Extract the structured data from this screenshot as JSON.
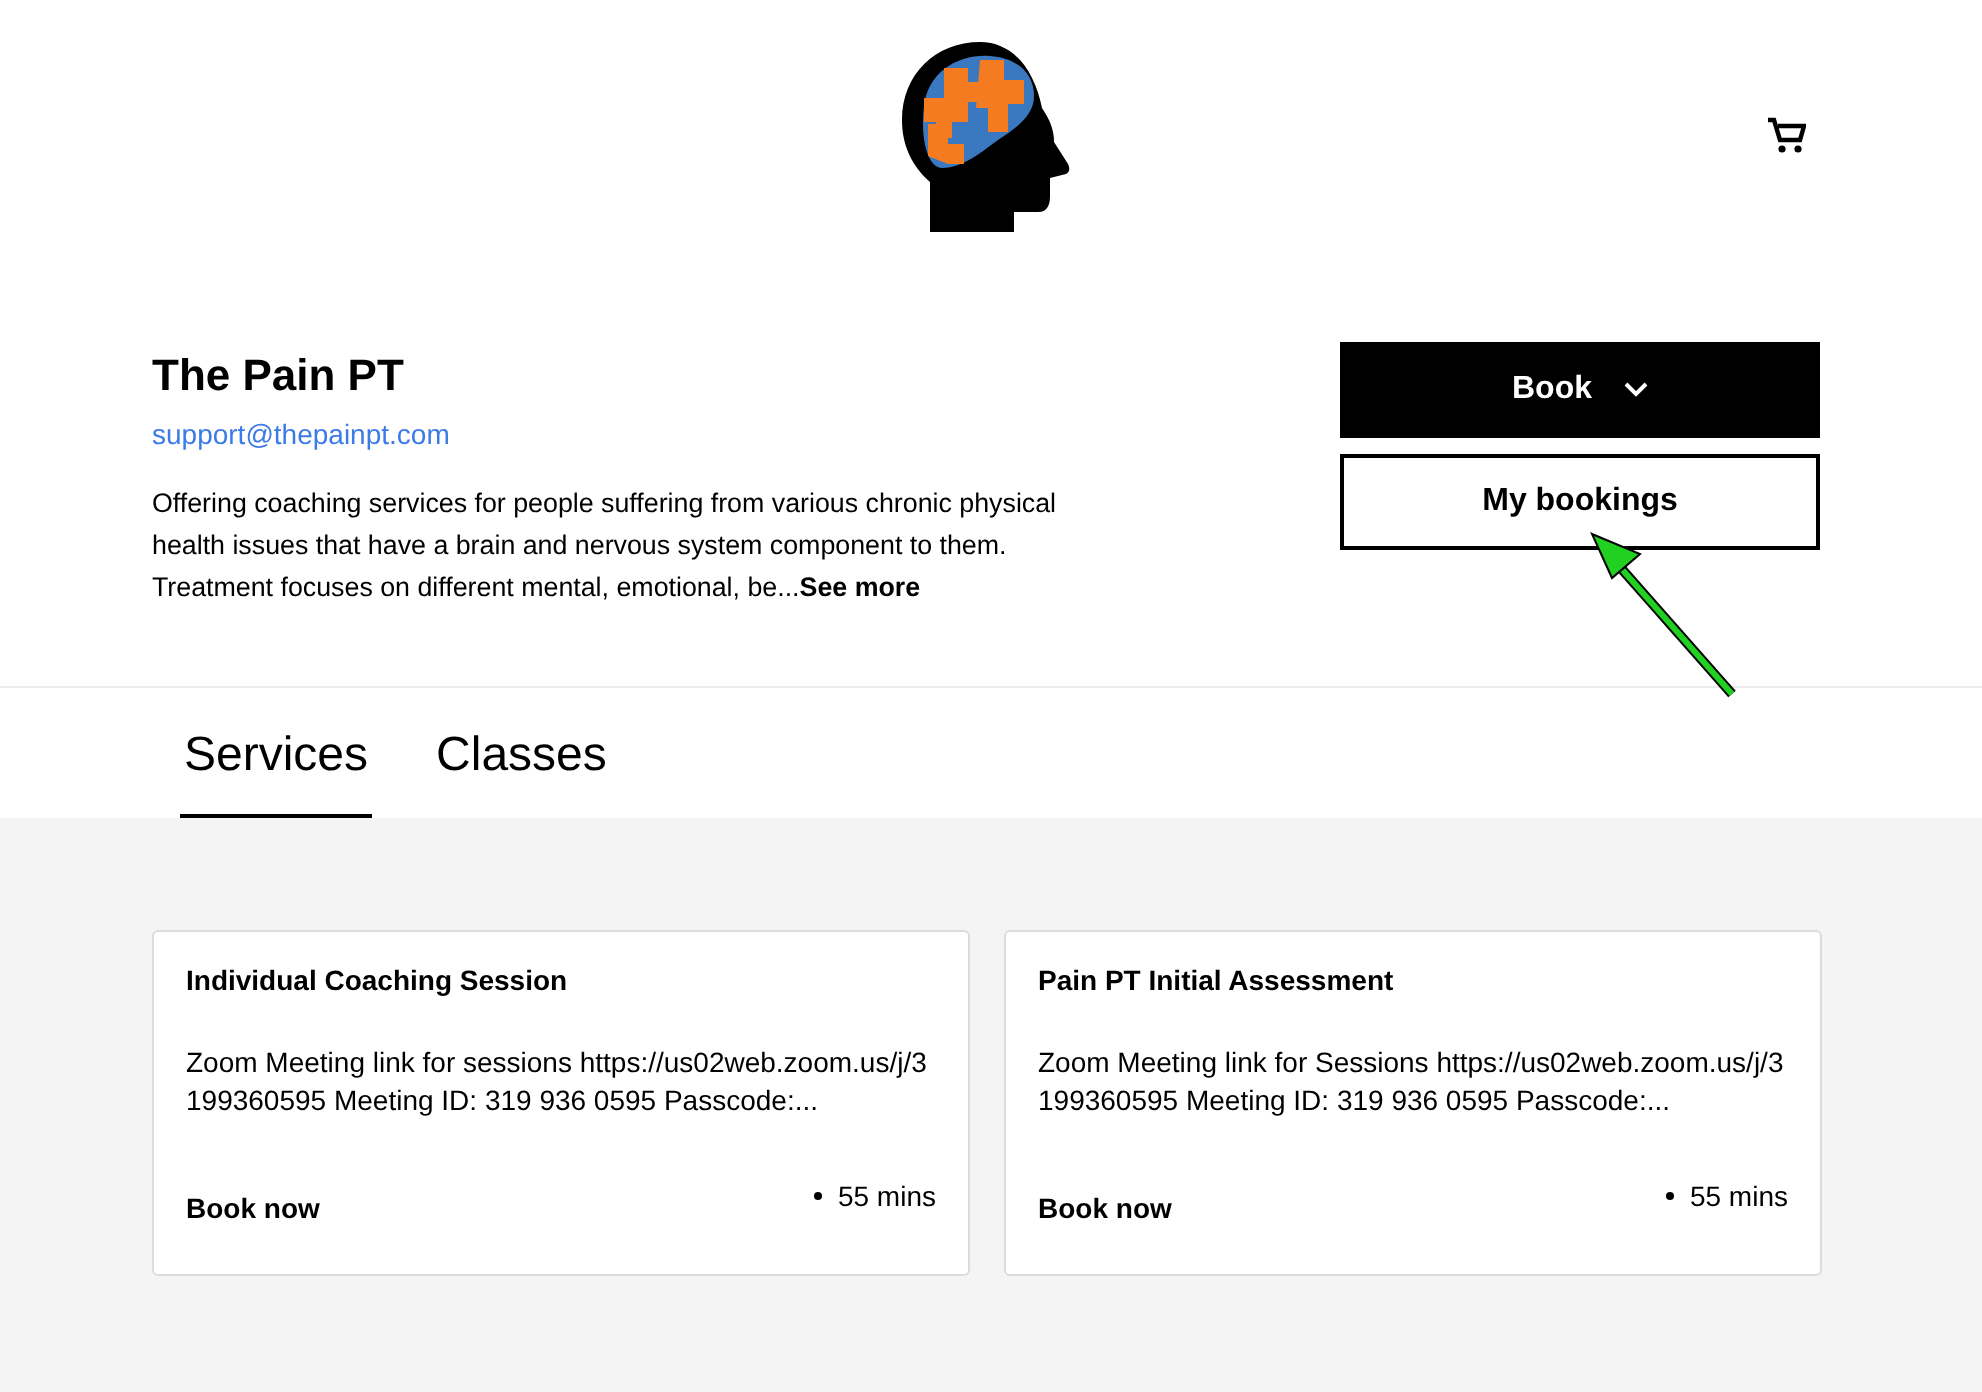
{
  "business": {
    "name": "The Pain PT",
    "email": "support@thepainpt.com",
    "description": "Offering coaching services for people suffering from various chronic physical health issues that have a brain and nervous system component to them. Treatment focuses on different mental, emotional, be...",
    "see_more": "See more"
  },
  "actions": {
    "book": "Book",
    "my_bookings": "My bookings"
  },
  "tabs": [
    {
      "label": "Services",
      "selected": true
    },
    {
      "label": "Classes",
      "selected": false
    }
  ],
  "services": [
    {
      "title": "Individual Coaching Session",
      "description": "Zoom Meeting link for sessions https://us02web.zoom.us/j/3199360595 Meeting ID: 319 936 0595 Passcode:...",
      "duration": "55 mins",
      "action": "Book now"
    },
    {
      "title": "Pain PT Initial Assessment",
      "description": "Zoom Meeting link for Sessions https://us02web.zoom.us/j/3199360595 Meeting ID: 319 936 0595 Passcode:...",
      "duration": "55 mins",
      "action": "Book now"
    }
  ]
}
